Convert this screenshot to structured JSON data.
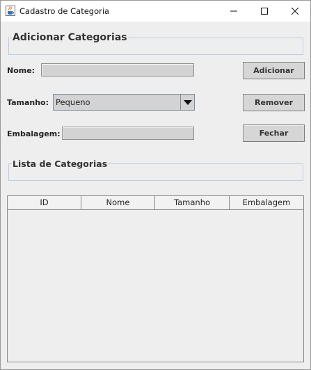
{
  "window": {
    "title": "Cadastro de Categoria",
    "icon": "java-cup-icon",
    "controls": [
      "minimize-icon",
      "maximize-icon",
      "close-icon"
    ]
  },
  "sections": {
    "add_title": "Adicionar Categorias",
    "list_title": "Lista de Categorias"
  },
  "form": {
    "nome_label": "Nome:",
    "nome_value": "",
    "tamanho_label": "Tamanho:",
    "tamanho_selected": "Pequeno",
    "embalagem_label": "Embalagem:",
    "embalagem_value": ""
  },
  "buttons": {
    "adicionar": "Adicionar",
    "remover": "Remover",
    "fechar": "Fechar"
  },
  "table": {
    "columns": [
      "ID",
      "Nome",
      "Tamanho",
      "Embalagem"
    ],
    "rows": []
  }
}
